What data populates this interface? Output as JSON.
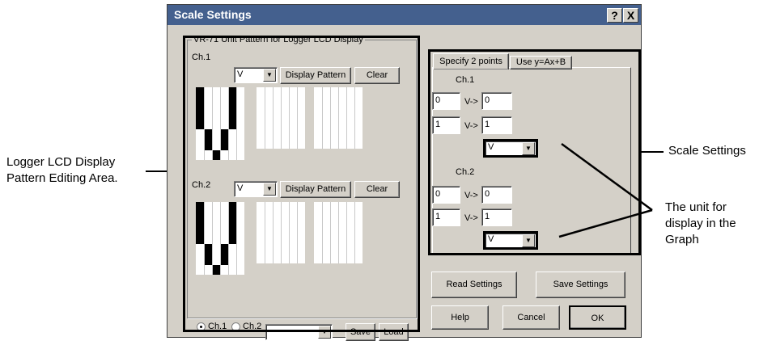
{
  "annotations": {
    "left_line1": "Logger LCD Display",
    "left_line2": "Pattern Editing Area.",
    "scale_settings": "Scale Settings",
    "unit_line1": "The unit for",
    "unit_line2": "display in the",
    "unit_line3": "Graph"
  },
  "dialog": {
    "title": "Scale Settings",
    "help_glyph": "?",
    "close_glyph": "X"
  },
  "pattern_group": {
    "title": "VR-71 Unit Pattern for Logger LCD Display",
    "ch1": {
      "label": "Ch.1",
      "unit": "V",
      "display_btn": "Display Pattern",
      "clear_btn": "Clear"
    },
    "ch2": {
      "label": "Ch.2",
      "unit": "V",
      "display_btn": "Display Pattern",
      "clear_btn": "Clear"
    },
    "radio_ch1": "Ch.1",
    "radio_ch2": "Ch.2",
    "preset_value": "",
    "save_btn": "Save",
    "load_btn": "Load"
  },
  "scale_panel": {
    "tab_active": "Specify 2 points",
    "tab_other": "Use y=Ax+B",
    "ch1": {
      "label": "Ch.1",
      "in1": "0",
      "out1": "0",
      "in2": "1",
      "out2": "1",
      "arrow": "V->",
      "unit": "V"
    },
    "ch2": {
      "label": "Ch.2",
      "in1": "0",
      "out1": "0",
      "in2": "1",
      "out2": "1",
      "arrow": "V->",
      "unit": "V"
    }
  },
  "buttons": {
    "read": "Read Settings",
    "save": "Save Settings",
    "help": "Help",
    "cancel": "Cancel",
    "ok": "OK"
  }
}
